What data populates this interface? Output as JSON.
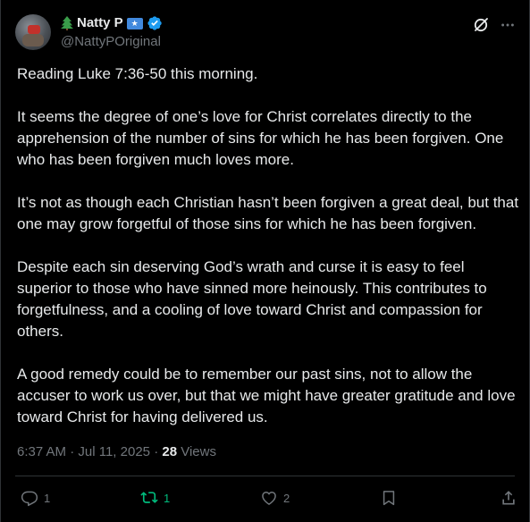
{
  "author": {
    "display_name": "Natty P",
    "handle": "@NattyPOriginal",
    "flag_glyph": "★"
  },
  "post": {
    "paragraphs": [
      "Reading Luke 7:36-50 this morning.",
      "It seems the degree of one’s love for Christ correlates directly to the apprehension of the number of sins for which he has been forgiven. One who has been forgiven much loves more.",
      "It’s not as though each Christian hasn’t been forgiven a great deal, but that one may grow forgetful of those sins for which he has been forgiven.",
      "Despite each sin deserving God’s wrath and curse it is easy to feel superior to those who have sinned more heinously. This contributes to forgetfulness, and a cooling of love toward Christ and compassion for others.",
      "A good remedy could be to remember our past sins, not to allow the accuser to work us over, but that we might have greater gratitude and love toward Christ for having delivered us."
    ],
    "time": "6:37 AM",
    "separator": "·",
    "date": "Jul 11, 2025",
    "views_count": "28",
    "views_label": "Views"
  },
  "actions": {
    "replies": "1",
    "reposts": "1",
    "likes": "2"
  },
  "colors": {
    "background": "#000000",
    "text": "#e7e9ea",
    "muted": "#71767b",
    "verified": "#1d9bf0",
    "repost_active": "#00ba7c",
    "divider": "#2f3336"
  },
  "icons": [
    "tree-icon",
    "flag-icon",
    "verified-icon",
    "grok-icon",
    "more-icon",
    "reply-icon",
    "repost-icon",
    "like-icon",
    "bookmark-icon",
    "share-icon"
  ]
}
